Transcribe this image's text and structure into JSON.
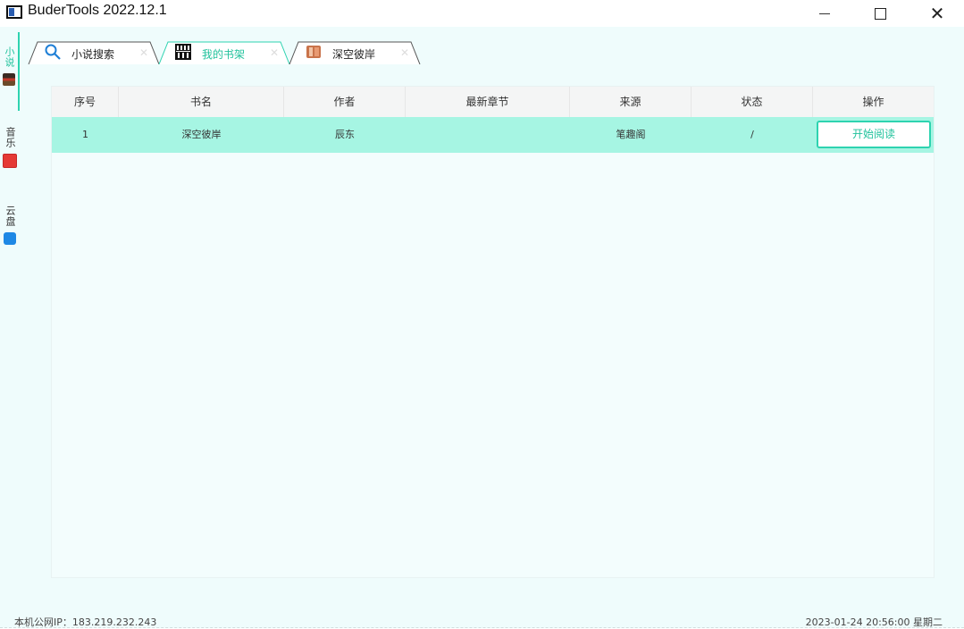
{
  "window": {
    "title": "BuderTools 2022.12.1",
    "controls": {
      "minimize": "minimize-icon",
      "maximize": "maximize-icon",
      "close": "✕"
    }
  },
  "side_tabs": [
    {
      "label": "小说",
      "icon": "novel-icon",
      "active": true
    },
    {
      "label": "音乐",
      "icon": "music-icon",
      "active": false
    },
    {
      "label": "云盘",
      "icon": "cloud-drive-icon",
      "active": false
    }
  ],
  "tabs": [
    {
      "label": "小说搜索",
      "icon": "search-icon",
      "active": false
    },
    {
      "label": "我的书架",
      "icon": "bookshelf-icon",
      "active": true
    },
    {
      "label": "深空彼岸",
      "icon": "book-icon",
      "active": false
    }
  ],
  "table": {
    "columns": [
      "序号",
      "书名",
      "作者",
      "最新章节",
      "来源",
      "状态",
      "操作"
    ],
    "rows": [
      {
        "index": "1",
        "title": "深空彼岸",
        "author": "辰东",
        "latest_chapter": "",
        "source": "笔趣阁",
        "status": "/",
        "action": "开始阅读"
      }
    ]
  },
  "status_bar": {
    "ip": "本机公网IP：183.219.232.243",
    "datetime": "2023-01-24 20:56:00 星期二"
  },
  "colors": {
    "accent": "#2ed3b0",
    "row_highlight": "#a6f5e3",
    "background": "#effcfc"
  }
}
